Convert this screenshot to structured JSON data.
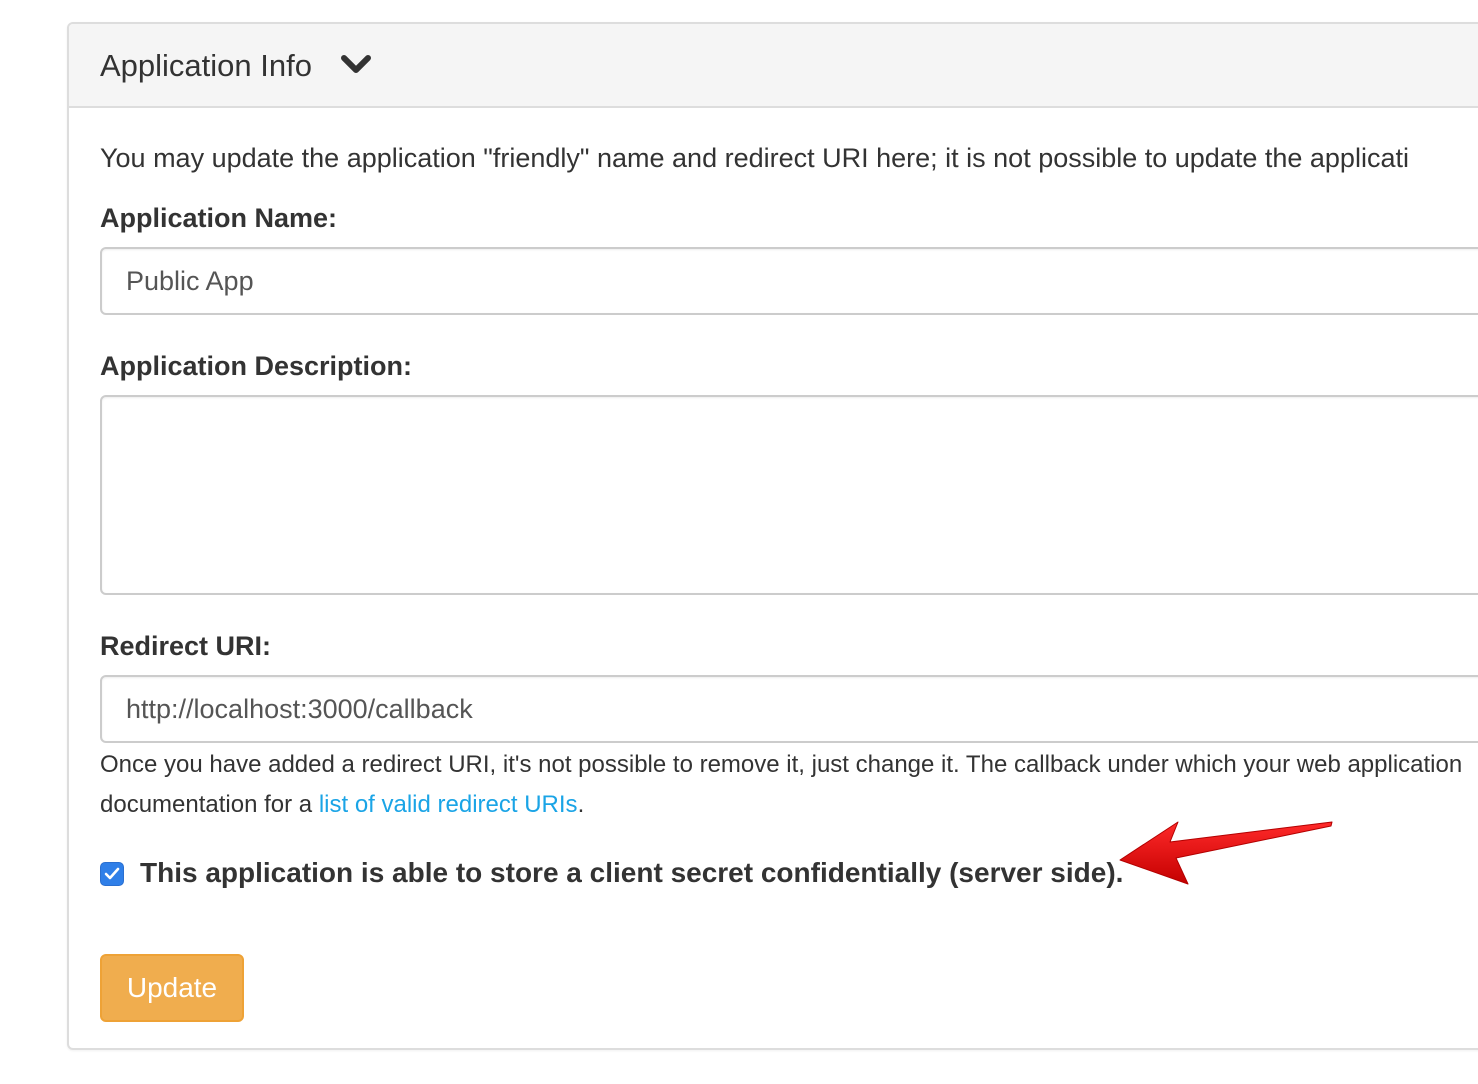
{
  "panel": {
    "title": "Application Info",
    "title_icon": "chevron-down-icon"
  },
  "intro_text": "You may update the application \"friendly\" name and redirect URI here; it is not possible to update the applicati",
  "app_name": {
    "label": "Application Name:",
    "value": "Public App"
  },
  "app_description": {
    "label": "Application Description:",
    "value": ""
  },
  "redirect": {
    "label": "Redirect URI:",
    "value": "http://localhost:3000/callback",
    "help_line1": "Once you have added a redirect URI, it's not possible to remove it, just change it. The callback under which your web application",
    "help_line2_prefix": "documentation for a ",
    "help_link": "list of valid redirect URIs",
    "help_line2_suffix": "."
  },
  "confidential": {
    "checked": true,
    "label": "This application is able to store a client secret confidentially (server side)."
  },
  "update_button": {
    "label": "Update",
    "color": "#f0ad4e"
  },
  "annotation": {
    "icon": "red-arrow-icon",
    "color": "#e60000"
  },
  "colors": {
    "link": "#1aa4e6",
    "checkbox": "#2f7fe8"
  }
}
